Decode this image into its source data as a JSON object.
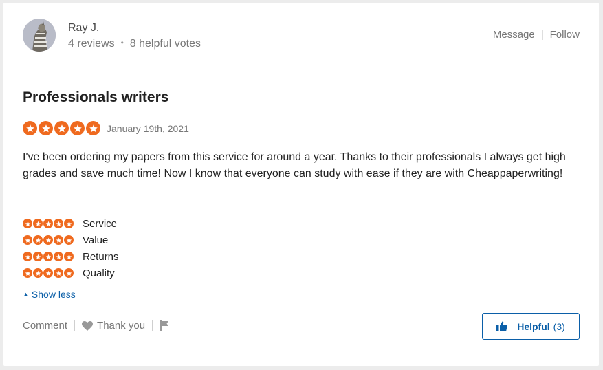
{
  "author": {
    "name": "Ray J.",
    "reviews": "4 reviews",
    "helpful_votes": "8 helpful votes"
  },
  "header_actions": {
    "message": "Message",
    "separator": "|",
    "follow": "Follow"
  },
  "review": {
    "title": "Professionals writers",
    "rating": 5,
    "date": "January 19th, 2021",
    "body": "I've been ordering my papers from this service for around a year. Thanks to their professionals I always get high grades and save much time! Now I know that everyone can study with ease if they are with Cheappaperwriting!"
  },
  "sub_ratings": [
    {
      "label": "Service",
      "rating": 5
    },
    {
      "label": "Value",
      "rating": 5
    },
    {
      "label": "Returns",
      "rating": 5
    },
    {
      "label": "Quality",
      "rating": 5
    }
  ],
  "show_less": "Show less",
  "footer": {
    "comment": "Comment",
    "thank_you": "Thank you",
    "helpful_label": "Helpful",
    "helpful_count": "(3)"
  },
  "colors": {
    "star": "#ef6a1f",
    "link": "#0b5fa8"
  },
  "icons": {
    "star": "star-icon",
    "heart": "heart-icon",
    "flag": "flag-icon",
    "thumbs_up": "thumbs-up-icon",
    "caret": "caret-up-icon"
  }
}
